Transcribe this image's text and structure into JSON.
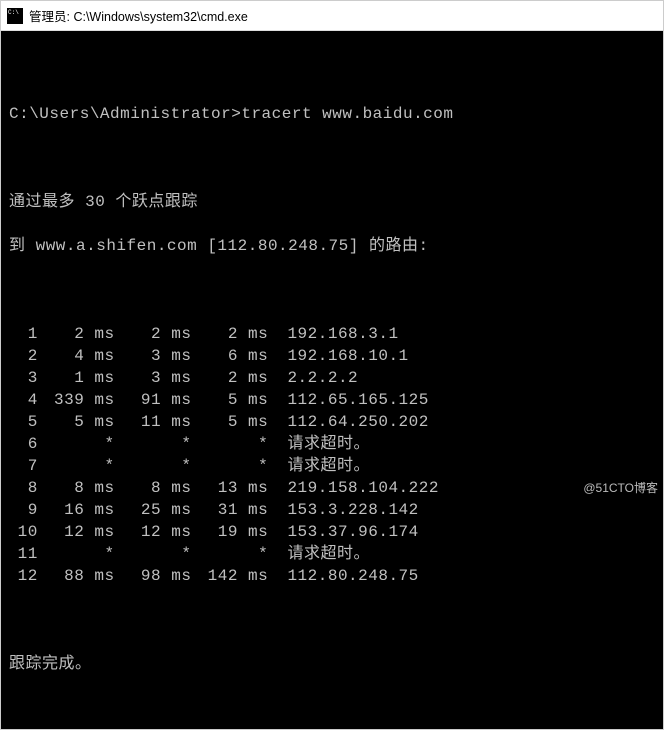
{
  "titlebar": {
    "text": "管理员: C:\\Windows\\system32\\cmd.exe"
  },
  "console": {
    "prompt": "C:\\Users\\Administrator>",
    "command": "tracert www.baidu.com",
    "intro1": "通过最多 30 个跃点跟踪",
    "intro2": "到 www.a.shifen.com [112.80.248.75] 的路由:",
    "hops": [
      {
        "n": "1",
        "t1": "2 ms",
        "t2": "2 ms",
        "t3": "2 ms",
        "host": "192.168.3.1"
      },
      {
        "n": "2",
        "t1": "4 ms",
        "t2": "3 ms",
        "t3": "6 ms",
        "host": "192.168.10.1"
      },
      {
        "n": "3",
        "t1": "1 ms",
        "t2": "3 ms",
        "t3": "2 ms",
        "host": "2.2.2.2"
      },
      {
        "n": "4",
        "t1": "339 ms",
        "t2": "91 ms",
        "t3": "5 ms",
        "host": "112.65.165.125"
      },
      {
        "n": "5",
        "t1": "5 ms",
        "t2": "11 ms",
        "t3": "5 ms",
        "host": "112.64.250.202"
      },
      {
        "n": "6",
        "t1": "*",
        "t2": "*",
        "t3": "*",
        "host": "请求超时。"
      },
      {
        "n": "7",
        "t1": "*",
        "t2": "*",
        "t3": "*",
        "host": "请求超时。"
      },
      {
        "n": "8",
        "t1": "8 ms",
        "t2": "8 ms",
        "t3": "13 ms",
        "host": "219.158.104.222"
      },
      {
        "n": "9",
        "t1": "16 ms",
        "t2": "25 ms",
        "t3": "31 ms",
        "host": "153.3.228.142"
      },
      {
        "n": "10",
        "t1": "12 ms",
        "t2": "12 ms",
        "t3": "19 ms",
        "host": "153.37.96.174"
      },
      {
        "n": "11",
        "t1": "*",
        "t2": "*",
        "t3": "*",
        "host": "请求超时。"
      },
      {
        "n": "12",
        "t1": "88 ms",
        "t2": "98 ms",
        "t3": "142 ms",
        "host": "112.80.248.75"
      }
    ],
    "done": "跟踪完成。"
  },
  "watermark": "@51CTO博客"
}
